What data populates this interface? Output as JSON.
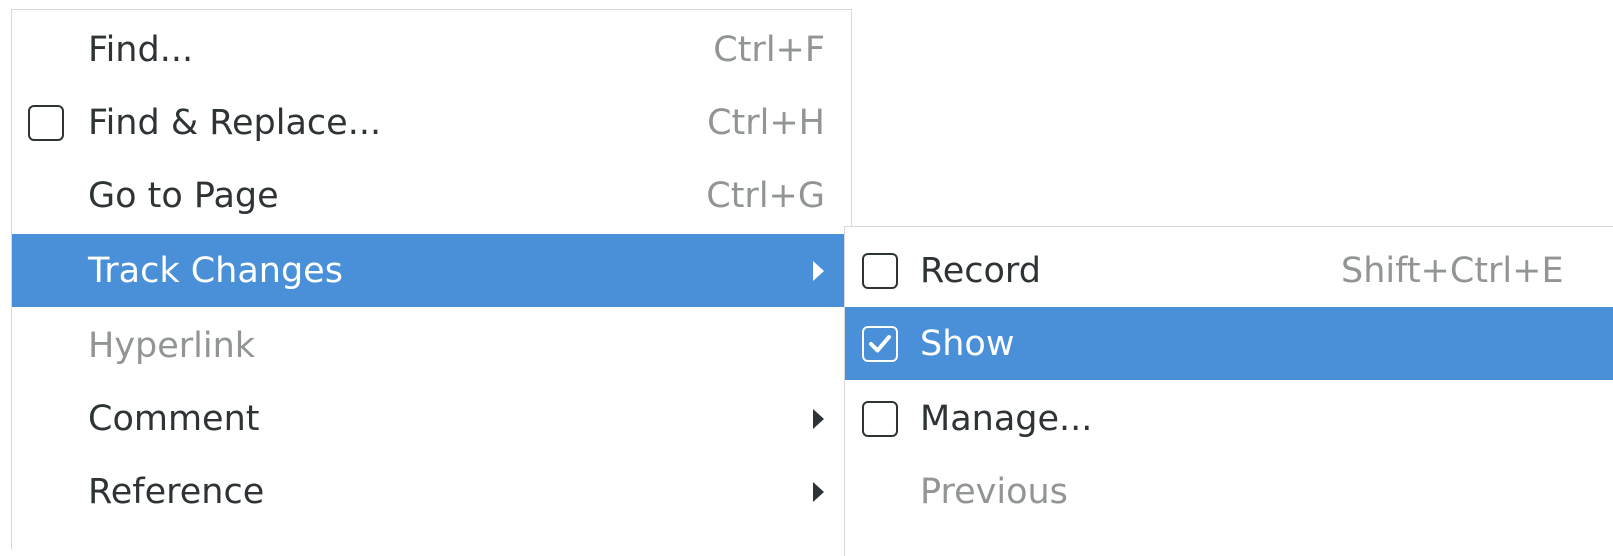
{
  "main_menu": {
    "items": [
      {
        "label": "Find...",
        "shortcut": "Ctrl+F"
      },
      {
        "label": "Find & Replace...",
        "shortcut": "Ctrl+H",
        "checked": false
      },
      {
        "label": "Go to Page",
        "shortcut": "Ctrl+G"
      },
      {
        "label": "Track Changes",
        "has_submenu": true,
        "highlighted": true
      },
      {
        "label": "Hyperlink",
        "disabled": true
      },
      {
        "label": "Comment",
        "has_submenu": true
      },
      {
        "label": "Reference",
        "has_submenu": true
      }
    ]
  },
  "track_changes_submenu": {
    "items": [
      {
        "label": "Record",
        "shortcut": "Shift+Ctrl+E",
        "checked": false
      },
      {
        "label": "Show",
        "checked": true,
        "highlighted": true
      },
      {
        "label": "Manage...",
        "checked": false
      },
      {
        "label": "Previous",
        "disabled": true
      }
    ]
  },
  "colors": {
    "highlight": "#4a90d9",
    "text": "#2e3436",
    "disabled_text": "#929595"
  }
}
